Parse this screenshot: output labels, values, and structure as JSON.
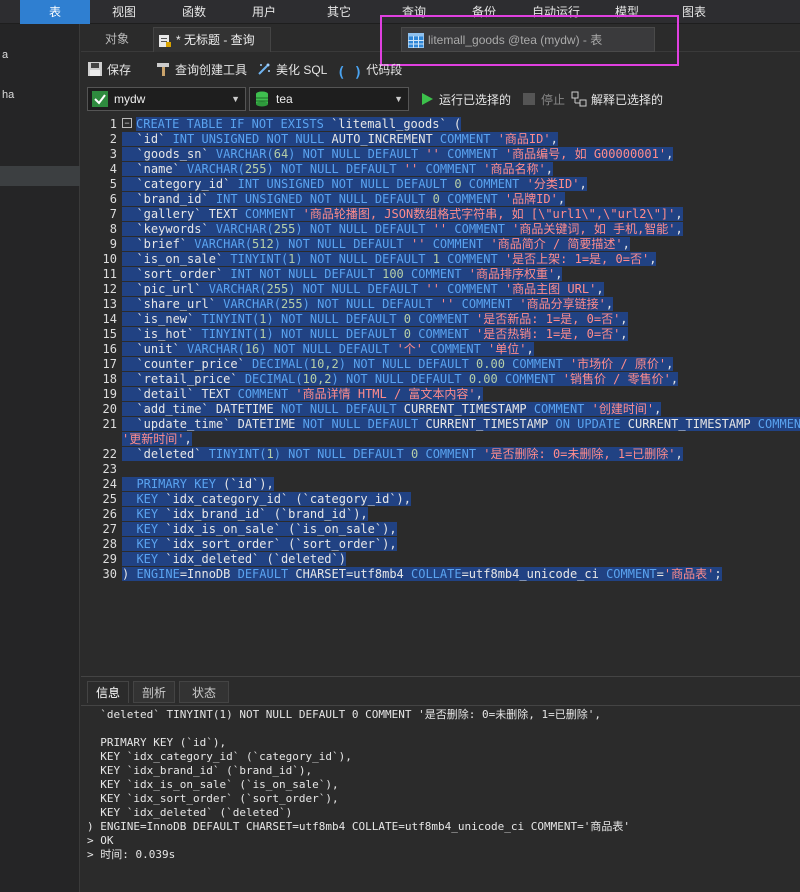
{
  "menu": {
    "items": [
      "表",
      "视图",
      "函数",
      "用户",
      "其它",
      "查询",
      "备份",
      "自动运行",
      "模型",
      "图表"
    ]
  },
  "sidebar": {
    "items": [
      "a",
      "ha"
    ]
  },
  "tabs": {
    "objects": "对象",
    "query_tab": "* 无标题 - 查询",
    "floating_tab": "litemall_goods @tea (mydw) - 表"
  },
  "toolbar": {
    "save": "保存",
    "query_builder": "查询创建工具",
    "beautify": "美化 SQL",
    "code_snippet": "代码段"
  },
  "selectors": {
    "connection": "mydw",
    "database": "tea",
    "run_selected": "运行已选择的",
    "stop": "停止",
    "explain": "解释已选择的"
  },
  "editor": {
    "line_numbers": [
      "1",
      "2",
      "3",
      "4",
      "5",
      "6",
      "7",
      "8",
      "9",
      "10",
      "11",
      "12",
      "13",
      "14",
      "15",
      "16",
      "17",
      "18",
      "19",
      "20",
      "21",
      "",
      "22",
      "23",
      "24",
      "25",
      "26",
      "27",
      "28",
      "29",
      "30"
    ],
    "lines": [
      [
        [
          "kw",
          "CREATE TABLE IF NOT EXISTS "
        ],
        [
          "id",
          "`litemall_goods` ("
        ]
      ],
      [
        [
          "id",
          "  `id` "
        ],
        [
          "kw",
          "INT UNSIGNED NOT NULL "
        ],
        [
          "id",
          "AUTO_INCREMENT "
        ],
        [
          "kw",
          "COMMENT "
        ],
        [
          "str",
          "'商品ID'"
        ],
        [
          "id",
          ","
        ]
      ],
      [
        [
          "id",
          "  `goods_sn` "
        ],
        [
          "kw",
          "VARCHAR("
        ],
        [
          "num",
          "64"
        ],
        [
          "kw",
          ") NOT NULL DEFAULT "
        ],
        [
          "str",
          "'' "
        ],
        [
          "kw",
          "COMMENT "
        ],
        [
          "str",
          "'商品编号, 如 G00000001'"
        ],
        [
          "id",
          ","
        ]
      ],
      [
        [
          "id",
          "  `name` "
        ],
        [
          "kw",
          "VARCHAR("
        ],
        [
          "num",
          "255"
        ],
        [
          "kw",
          ") NOT NULL DEFAULT "
        ],
        [
          "str",
          "'' "
        ],
        [
          "kw",
          "COMMENT "
        ],
        [
          "str",
          "'商品名称'"
        ],
        [
          "id",
          ","
        ]
      ],
      [
        [
          "id",
          "  `category_id` "
        ],
        [
          "kw",
          "INT UNSIGNED NOT NULL DEFAULT "
        ],
        [
          "num",
          "0 "
        ],
        [
          "kw",
          "COMMENT "
        ],
        [
          "str",
          "'分类ID'"
        ],
        [
          "id",
          ","
        ]
      ],
      [
        [
          "id",
          "  `brand_id` "
        ],
        [
          "kw",
          "INT UNSIGNED NOT NULL DEFAULT "
        ],
        [
          "num",
          "0 "
        ],
        [
          "kw",
          "COMMENT "
        ],
        [
          "str",
          "'品牌ID'"
        ],
        [
          "id",
          ","
        ]
      ],
      [
        [
          "id",
          "  `gallery` TEXT "
        ],
        [
          "kw",
          "COMMENT "
        ],
        [
          "str",
          "'商品轮播图, JSON数组格式字符串, 如 [\\\"url1\\\",\\\"url2\\\"]'"
        ],
        [
          "id",
          ","
        ]
      ],
      [
        [
          "id",
          "  `keywords` "
        ],
        [
          "kw",
          "VARCHAR("
        ],
        [
          "num",
          "255"
        ],
        [
          "kw",
          ") NOT NULL DEFAULT "
        ],
        [
          "str",
          "'' "
        ],
        [
          "kw",
          "COMMENT "
        ],
        [
          "str",
          "'商品关键词, 如 手机,智能'"
        ],
        [
          "id",
          ","
        ]
      ],
      [
        [
          "id",
          "  `brief` "
        ],
        [
          "kw",
          "VARCHAR("
        ],
        [
          "num",
          "512"
        ],
        [
          "kw",
          ") NOT NULL DEFAULT "
        ],
        [
          "str",
          "'' "
        ],
        [
          "kw",
          "COMMENT "
        ],
        [
          "str",
          "'商品简介 / 简要描述'"
        ],
        [
          "id",
          ","
        ]
      ],
      [
        [
          "id",
          "  `is_on_sale` "
        ],
        [
          "kw",
          "TINYINT("
        ],
        [
          "num",
          "1"
        ],
        [
          "kw",
          ") NOT NULL DEFAULT "
        ],
        [
          "num",
          "1 "
        ],
        [
          "kw",
          "COMMENT "
        ],
        [
          "str",
          "'是否上架: 1=是, 0=否'"
        ],
        [
          "id",
          ","
        ]
      ],
      [
        [
          "id",
          "  `sort_order` "
        ],
        [
          "kw",
          "INT NOT NULL DEFAULT "
        ],
        [
          "num",
          "100 "
        ],
        [
          "kw",
          "COMMENT "
        ],
        [
          "str",
          "'商品排序权重'"
        ],
        [
          "id",
          ","
        ]
      ],
      [
        [
          "id",
          "  `pic_url` "
        ],
        [
          "kw",
          "VARCHAR("
        ],
        [
          "num",
          "255"
        ],
        [
          "kw",
          ") NOT NULL DEFAULT "
        ],
        [
          "str",
          "'' "
        ],
        [
          "kw",
          "COMMENT "
        ],
        [
          "str",
          "'商品主图 URL'"
        ],
        [
          "id",
          ","
        ]
      ],
      [
        [
          "id",
          "  `share_url` "
        ],
        [
          "kw",
          "VARCHAR("
        ],
        [
          "num",
          "255"
        ],
        [
          "kw",
          ") NOT NULL DEFAULT "
        ],
        [
          "str",
          "'' "
        ],
        [
          "kw",
          "COMMENT "
        ],
        [
          "str",
          "'商品分享链接'"
        ],
        [
          "id",
          ","
        ]
      ],
      [
        [
          "id",
          "  `is_new` "
        ],
        [
          "kw",
          "TINYINT("
        ],
        [
          "num",
          "1"
        ],
        [
          "kw",
          ") NOT NULL DEFAULT "
        ],
        [
          "num",
          "0 "
        ],
        [
          "kw",
          "COMMENT "
        ],
        [
          "str",
          "'是否新品: 1=是, 0=否'"
        ],
        [
          "id",
          ","
        ]
      ],
      [
        [
          "id",
          "  `is_hot` "
        ],
        [
          "kw",
          "TINYINT("
        ],
        [
          "num",
          "1"
        ],
        [
          "kw",
          ") NOT NULL DEFAULT "
        ],
        [
          "num",
          "0 "
        ],
        [
          "kw",
          "COMMENT "
        ],
        [
          "str",
          "'是否热销: 1=是, 0=否'"
        ],
        [
          "id",
          ","
        ]
      ],
      [
        [
          "id",
          "  `unit` "
        ],
        [
          "kw",
          "VARCHAR("
        ],
        [
          "num",
          "16"
        ],
        [
          "kw",
          ") NOT NULL DEFAULT "
        ],
        [
          "str",
          "'个' "
        ],
        [
          "kw",
          "COMMENT "
        ],
        [
          "str",
          "'单位'"
        ],
        [
          "id",
          ","
        ]
      ],
      [
        [
          "id",
          "  `counter_price` "
        ],
        [
          "kw",
          "DECIMAL("
        ],
        [
          "num",
          "10,2"
        ],
        [
          "kw",
          ") NOT NULL DEFAULT "
        ],
        [
          "num",
          "0.00 "
        ],
        [
          "kw",
          "COMMENT "
        ],
        [
          "str",
          "'市场价 / 原价'"
        ],
        [
          "id",
          ","
        ]
      ],
      [
        [
          "id",
          "  `retail_price` "
        ],
        [
          "kw",
          "DECIMAL("
        ],
        [
          "num",
          "10,2"
        ],
        [
          "kw",
          ") NOT NULL DEFAULT "
        ],
        [
          "num",
          "0.00 "
        ],
        [
          "kw",
          "COMMENT "
        ],
        [
          "str",
          "'销售价 / 零售价'"
        ],
        [
          "id",
          ","
        ]
      ],
      [
        [
          "id",
          "  `detail` TEXT "
        ],
        [
          "kw",
          "COMMENT "
        ],
        [
          "str",
          "'商品详情 HTML / 富文本内容'"
        ],
        [
          "id",
          ","
        ]
      ],
      [
        [
          "id",
          "  `add_time` DATETIME "
        ],
        [
          "kw",
          "NOT NULL DEFAULT "
        ],
        [
          "id",
          "CURRENT_TIMESTAMP "
        ],
        [
          "kw",
          "COMMENT "
        ],
        [
          "str",
          "'创建时间'"
        ],
        [
          "id",
          ","
        ]
      ],
      [
        [
          "id",
          "  `update_time` DATETIME "
        ],
        [
          "kw",
          "NOT NULL DEFAULT "
        ],
        [
          "id",
          "CURRENT_TIMESTAMP "
        ],
        [
          "kw",
          "ON UPDATE "
        ],
        [
          "id",
          "CURRENT_TIMESTAMP "
        ],
        [
          "kw",
          "COMMENT"
        ]
      ],
      [
        [
          "str",
          "'更新时间'"
        ],
        [
          "id",
          ","
        ]
      ],
      [
        [
          "id",
          "  `deleted` "
        ],
        [
          "kw",
          "TINYINT("
        ],
        [
          "num",
          "1"
        ],
        [
          "kw",
          ") NOT NULL DEFAULT "
        ],
        [
          "num",
          "0 "
        ],
        [
          "kw",
          "COMMENT "
        ],
        [
          "str",
          "'是否删除: 0=未删除, 1=已删除'"
        ],
        [
          "id",
          ","
        ]
      ],
      [
        [
          "id",
          ""
        ]
      ],
      [
        [
          "kw",
          "  PRIMARY KEY "
        ],
        [
          "id",
          "(`id`),"
        ]
      ],
      [
        [
          "kw",
          "  KEY "
        ],
        [
          "id",
          "`idx_category_id` (`category_id`),"
        ]
      ],
      [
        [
          "kw",
          "  KEY "
        ],
        [
          "id",
          "`idx_brand_id` (`brand_id`),"
        ]
      ],
      [
        [
          "kw",
          "  KEY "
        ],
        [
          "id",
          "`idx_is_on_sale` (`is_on_sale`),"
        ]
      ],
      [
        [
          "kw",
          "  KEY "
        ],
        [
          "id",
          "`idx_sort_order` (`sort_order`),"
        ]
      ],
      [
        [
          "kw",
          "  KEY "
        ],
        [
          "id",
          "`idx_deleted` (`deleted`)"
        ]
      ],
      [
        [
          "id",
          ") "
        ],
        [
          "kw",
          "ENGINE"
        ],
        [
          "id",
          "=InnoDB "
        ],
        [
          "kw",
          "DEFAULT "
        ],
        [
          "id",
          "CHARSET=utf8mb4 "
        ],
        [
          "kw",
          "COLLATE"
        ],
        [
          "id",
          "=utf8mb4_unicode_ci "
        ],
        [
          "kw",
          "COMMENT"
        ],
        [
          "id",
          "="
        ],
        [
          "str",
          "'商品表'"
        ],
        [
          "id",
          ";"
        ]
      ]
    ]
  },
  "bottom": {
    "tabs": [
      "信息",
      "剖析",
      "状态"
    ],
    "output_lines": [
      "  `deleted` TINYINT(1) NOT NULL DEFAULT 0 COMMENT '是否删除: 0=未删除, 1=已删除',",
      "",
      "  PRIMARY KEY (`id`),",
      "  KEY `idx_category_id` (`category_id`),",
      "  KEY `idx_brand_id` (`brand_id`),",
      "  KEY `idx_is_on_sale` (`is_on_sale`),",
      "  KEY `idx_sort_order` (`sort_order`),",
      "  KEY `idx_deleted` (`deleted`)",
      ") ENGINE=InnoDB DEFAULT CHARSET=utf8mb4 COLLATE=utf8mb4_unicode_ci COMMENT='商品表'",
      "> OK",
      "> 时间: 0.039s"
    ]
  }
}
